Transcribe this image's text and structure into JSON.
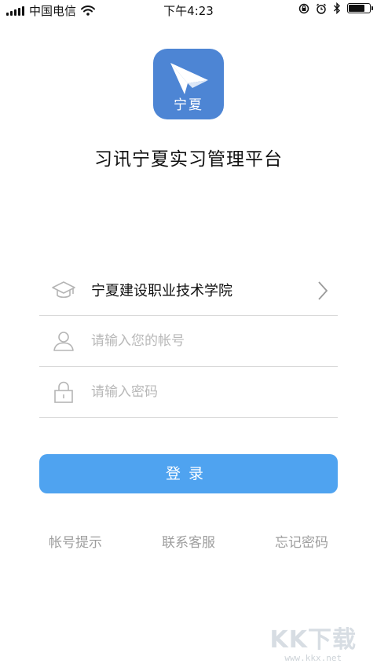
{
  "status_bar": {
    "carrier": "中国电信",
    "time": "下午4:23",
    "battery_level": 0.85
  },
  "app": {
    "icon_text": "宁夏",
    "icon_color": "#4d85d4",
    "title": "习讯宁夏实习管理平台"
  },
  "form": {
    "school": {
      "icon": "graduation-cap-icon",
      "value": "宁夏建设职业技术学院"
    },
    "account": {
      "icon": "user-icon",
      "value": "",
      "placeholder": "请输入您的帐号"
    },
    "password": {
      "icon": "lock-icon",
      "value": "",
      "placeholder": "请输入密码"
    }
  },
  "login_button": {
    "label": "登录",
    "color": "#4fa3f0"
  },
  "links": {
    "account_hint": "帐号提示",
    "contact_support": "联系客服",
    "forgot_password": "忘记密码"
  },
  "watermark": {
    "logo": "KK下载",
    "url": "www.kkx.net"
  }
}
